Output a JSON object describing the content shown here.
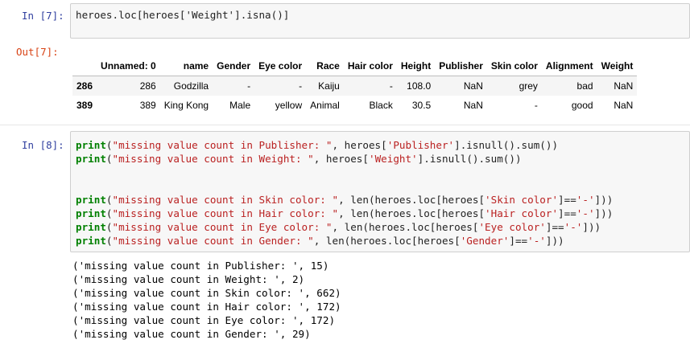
{
  "cell7": {
    "in_prompt": "In [7]:",
    "code": "heroes.loc[heroes['Weight'].isna()]",
    "out_prompt": "Out[7]:",
    "table": {
      "columns": [
        "",
        "Unnamed: 0",
        "name",
        "Gender",
        "Eye color",
        "Race",
        "Hair color",
        "Height",
        "Publisher",
        "Skin color",
        "Alignment",
        "Weight"
      ],
      "rows": [
        {
          "index": "286",
          "cells": [
            "286",
            "Godzilla",
            "-",
            "-",
            "Kaiju",
            "-",
            "108.0",
            "NaN",
            "grey",
            "bad",
            "NaN"
          ]
        },
        {
          "index": "389",
          "cells": [
            "389",
            "King Kong",
            "Male",
            "yellow",
            "Animal",
            "Black",
            "30.5",
            "NaN",
            "-",
            "good",
            "NaN"
          ]
        }
      ]
    }
  },
  "cell8": {
    "in_prompt": "In [8]:",
    "lines": [
      {
        "kw": "print",
        "rest1": "(",
        "str": "\"missing value count in Publisher: \"",
        "rest2": ", heroes[",
        "str2": "'Publisher'",
        "rest3": "].isnull().sum())"
      },
      {
        "kw": "print",
        "rest1": "(",
        "str": "\"missing value count in Weight: \"",
        "rest2": ", heroes[",
        "str2": "'Weight'",
        "rest3": "].isnull().sum())"
      },
      {
        "kw": "",
        "rest1": "",
        "str": "",
        "rest2": "",
        "str2": "",
        "rest3": ""
      },
      {
        "kw": "",
        "rest1": "",
        "str": "",
        "rest2": "",
        "str2": "",
        "rest3": ""
      },
      {
        "kw": "print",
        "rest1": "(",
        "str": "\"missing value count in Skin color: \"",
        "rest2": ", len(heroes.loc[heroes[",
        "str2": "'Skin color'",
        "rest3": "]==",
        "str3": "'-'",
        "rest4": "]))"
      },
      {
        "kw": "print",
        "rest1": "(",
        "str": "\"missing value count in Hair color: \"",
        "rest2": ", len(heroes.loc[heroes[",
        "str2": "'Hair color'",
        "rest3": "]==",
        "str3": "'-'",
        "rest4": "]))"
      },
      {
        "kw": "print",
        "rest1": "(",
        "str": "\"missing value count in Eye color: \"",
        "rest2": ", len(heroes.loc[heroes[",
        "str2": "'Eye color'",
        "rest3": "]==",
        "str3": "'-'",
        "rest4": "]))"
      },
      {
        "kw": "print",
        "rest1": "(",
        "str": "\"missing value count in Gender: \"",
        "rest2": ", len(heroes.loc[heroes[",
        "str2": "'Gender'",
        "rest3": "]==",
        "str3": "'-'",
        "rest4": "]))"
      }
    ],
    "output": [
      "('missing value count in Publisher: ', 15)",
      "('missing value count in Weight: ', 2)",
      "('missing value count in Skin color: ', 662)",
      "('missing value count in Hair color: ', 172)",
      "('missing value count in Eye color: ', 172)",
      "('missing value count in Gender: ', 29)"
    ]
  }
}
